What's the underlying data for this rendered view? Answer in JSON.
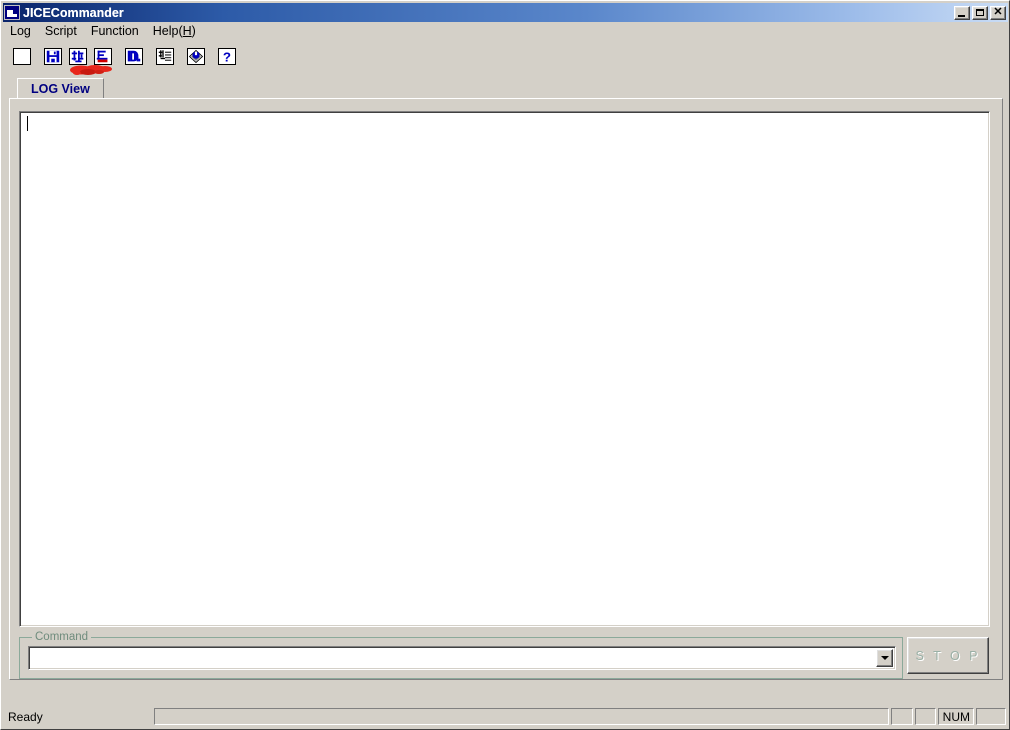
{
  "window": {
    "title": "JICECommander",
    "icon": "app-icon",
    "controls": {
      "minimize": "_",
      "maximize": "□",
      "close": "✕"
    }
  },
  "menu": {
    "items": [
      {
        "label": "Log",
        "accel": ""
      },
      {
        "label": "Script",
        "accel": ""
      },
      {
        "label": "Function",
        "accel": ""
      },
      {
        "label": "Help(",
        "accel": "H",
        "suffix": ")"
      }
    ]
  },
  "toolbar": {
    "buttons": [
      {
        "name": "new-document",
        "title": "New"
      },
      {
        "name": "save-floppy",
        "title": "Save"
      },
      {
        "name": "jice-connect",
        "title": "Connect"
      },
      {
        "name": "jice-file",
        "title": "JICE File"
      },
      {
        "name": "download-d",
        "title": "Download"
      },
      {
        "name": "script-list",
        "title": "Script List"
      },
      {
        "name": "target-diamond",
        "title": "Target"
      },
      {
        "name": "help-question",
        "title": "Help"
      }
    ]
  },
  "tabs": [
    {
      "label": "LOG View",
      "active": true
    }
  ],
  "logview": {
    "content": "",
    "caret": true
  },
  "command": {
    "group_label": "Command",
    "value": "",
    "placeholder": "",
    "dropdown_options": []
  },
  "stop_button": {
    "label": "S T O P",
    "enabled": false
  },
  "statusbar": {
    "message": "Ready",
    "panes": [
      "",
      "",
      "",
      ""
    ],
    "num_indicator": "NUM"
  },
  "annotation": {
    "type": "red-marker-scribble",
    "color": "#e8271c",
    "near": "toolbar-button-jice-connect"
  },
  "colors": {
    "title_start": "#0a246a",
    "title_end": "#c9dcf5",
    "face": "#d4d0c8",
    "tab_text": "#000080",
    "group_border": "#8ba99a",
    "group_label": "#6f8c7d",
    "icon_blue": "#0000c0",
    "icon_red": "#d00000"
  }
}
